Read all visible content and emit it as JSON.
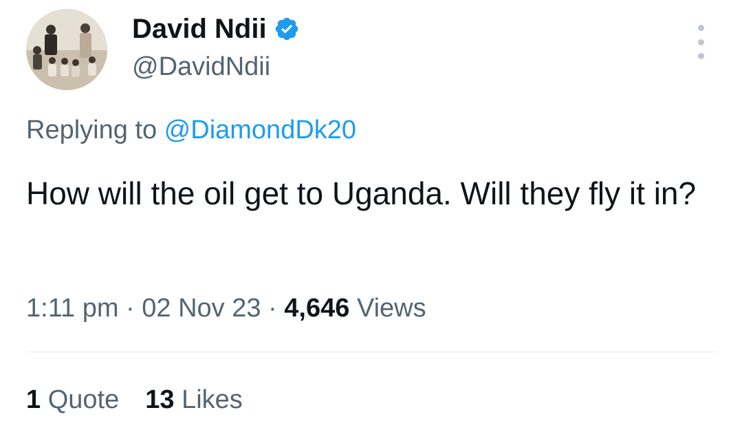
{
  "author": {
    "display_name": "David Ndii",
    "handle": "@DavidNdii",
    "verified_icon": "verified-badge-icon",
    "avatar": "vintage-family-photo"
  },
  "more_icon": "more-options-icon",
  "reply": {
    "prefix": "Replying to ",
    "mention": "@DiamondDk20"
  },
  "tweet": {
    "text": "How will the oil get to Uganda. Will they fly it in?"
  },
  "meta": {
    "time": "1:11 pm",
    "separator": " · ",
    "date": "02 Nov 23",
    "views_count": "4,646",
    "views_label": "Views"
  },
  "stats": {
    "quotes_count": "1",
    "quotes_label": "Quote",
    "likes_count": "13",
    "likes_label": "Likes"
  },
  "colors": {
    "primary_text": "#0f1419",
    "secondary_text": "#536471",
    "link": "#1d9bf0",
    "divider": "#e6e8ea"
  }
}
